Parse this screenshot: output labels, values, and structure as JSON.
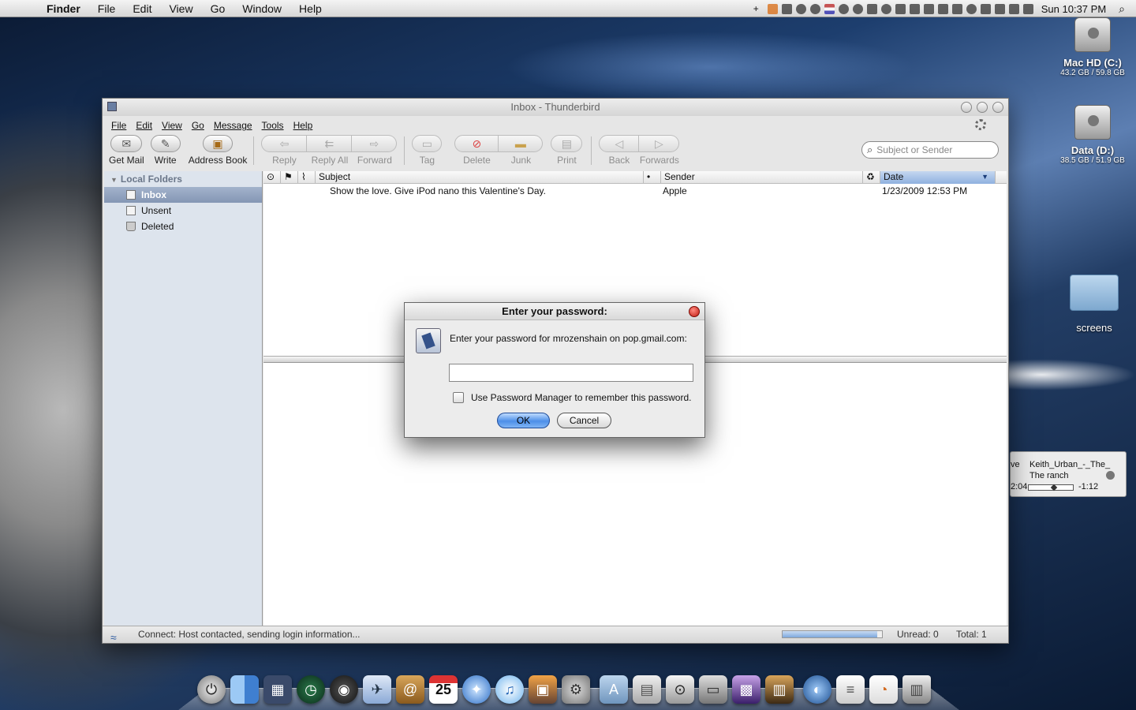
{
  "menubar": {
    "app": "Finder",
    "items": [
      "File",
      "Edit",
      "View",
      "Go",
      "Window",
      "Help"
    ],
    "clock": "Sun 10:37 PM"
  },
  "desktop": {
    "icons": [
      {
        "name": "Mac HD (C:)",
        "sub": "43.2 GB / 59.8 GB"
      },
      {
        "name": "Data (D:)",
        "sub": "38.5 GB / 51.9 GB"
      },
      {
        "name": "screens",
        "sub": ""
      }
    ]
  },
  "player": {
    "title_left": "ve",
    "title": "Keith_Urban_-_The_",
    "title2": "The ranch",
    "time_left": "2:04",
    "time_right": "-1:12",
    "position": 0.6
  },
  "window": {
    "title": "Inbox - Thunderbird",
    "menu": [
      "File",
      "Edit",
      "View",
      "Go",
      "Message",
      "Tools",
      "Help"
    ],
    "toolbar": {
      "get_mail": "Get Mail",
      "write": "Write",
      "address_book": "Address Book",
      "reply": "Reply",
      "reply_all": "Reply All",
      "forward": "Forward",
      "tag": "Tag",
      "delete": "Delete",
      "junk": "Junk",
      "print": "Print",
      "back": "Back",
      "forwards": "Forwards"
    },
    "search_placeholder": "Subject or Sender",
    "folders": {
      "root": "Local Folders",
      "items": [
        "Inbox",
        "Unsent",
        "Deleted"
      ]
    },
    "columns": {
      "subject": "Subject",
      "sender": "Sender",
      "date": "Date"
    },
    "messages": [
      {
        "subject": "Show the love. Give iPod nano this Valentine's Day.",
        "sender": "Apple",
        "date": "1/23/2009 12:53 PM"
      }
    ],
    "status": {
      "text": "Connect: Host contacted, sending login information...",
      "unread": "Unread: 0",
      "total": "Total: 1",
      "progress": 0.95
    }
  },
  "dialog": {
    "title": "Enter your password:",
    "message": "Enter your password for mrozenshain on pop.gmail.com:",
    "password_value": "",
    "checkbox_label": "Use Password Manager to remember this password.",
    "ok": "OK",
    "cancel": "Cancel"
  },
  "dock": {
    "items": [
      "power-icon",
      "finder-icon",
      "dashboard-icon",
      "time-machine-icon",
      "dashboard-gauge-icon",
      "mail-stamp-icon",
      "address-book-icon",
      "ical-icon",
      "safari-icon",
      "itunes-icon",
      "iphoto-icon",
      "system-preferences-icon",
      "applications-folder-icon",
      "documents-folder-icon",
      "downloads-folder-icon",
      "docs-stack-icon",
      "pictures-stack-icon",
      "photos-stack-icon",
      "network-globe-icon",
      "document-icon",
      "firefox-doc-icon",
      "trash-icon"
    ]
  },
  "colors": {
    "accent": "#3d7be0",
    "selection": "#8496b4",
    "close_red": "#c01a10"
  }
}
